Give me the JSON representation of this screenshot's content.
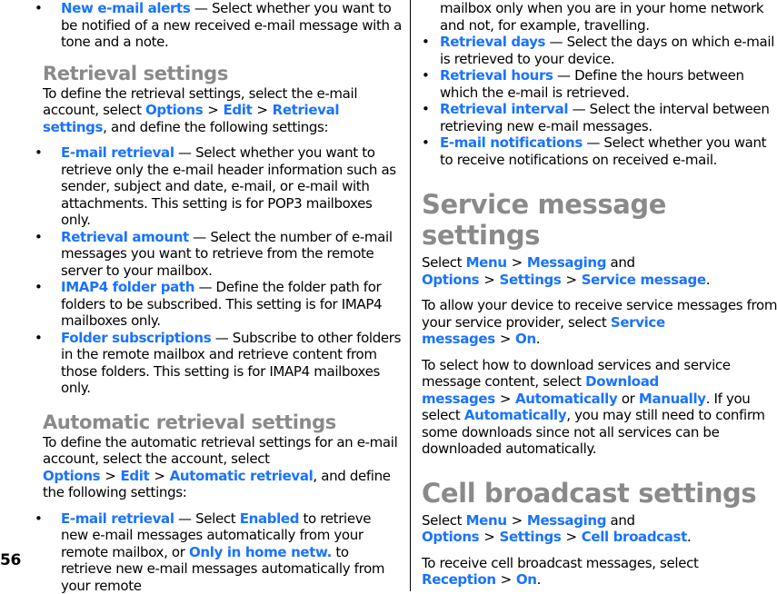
{
  "page_number": "56",
  "left": {
    "intro_item": {
      "term": "New e-mail alerts",
      "desc": " — Select whether you want to be notified of a new received e-mail message with a tone and a note."
    },
    "retrieval": {
      "heading": "Retrieval settings",
      "intro_pre": "To define the retrieval settings, select the e-mail account, select ",
      "path": [
        "Options",
        "Edit",
        "Retrieval settings"
      ],
      "intro_post": ", and define the following settings:",
      "items": [
        {
          "term": "E-mail retrieval",
          "desc": " — Select whether you want to retrieve only the e-mail header information such as sender, subject and date, e-mail, or e-mail with attachments. This setting is for POP3 mailboxes only."
        },
        {
          "term": "Retrieval amount",
          "desc": " — Select the number of e-mail messages you want to retrieve from the remote server to your mailbox."
        },
        {
          "term": "IMAP4 folder path",
          "desc": " — Define the folder path for folders to be subscribed. This setting is for IMAP4 mailboxes only."
        },
        {
          "term": "Folder subscriptions",
          "desc": " — Subscribe to other folders in the remote mailbox and retrieve content from those folders. This setting is for IMAP4 mailboxes only."
        }
      ]
    },
    "automatic": {
      "heading": "Automatic retrieval settings",
      "intro_pre": "To define the automatic retrieval settings for an e-mail account, select the account, select ",
      "path": [
        "Options",
        "Edit",
        "Automatic retrieval"
      ],
      "intro_post": ", and define the following settings:",
      "item0": {
        "term": "E-mail retrieval",
        "desc_a": " — Select ",
        "opt1": "Enabled",
        "desc_b": " to retrieve new e-mail messages automatically from your remote mailbox, or ",
        "opt2": "Only in home netw.",
        "desc_c": " to retrieve new e-mail messages automatically from your remote"
      }
    }
  },
  "right": {
    "continuation": "mailbox only when you are in your home network and not, for example, travelling.",
    "items": [
      {
        "term": "Retrieval days",
        "desc": " — Select the days on which e-mail is retrieved to your device."
      },
      {
        "term": "Retrieval hours",
        "desc": " — Define the hours between which the e-mail is retrieved."
      },
      {
        "term": "Retrieval interval",
        "desc": " — Select the interval between retrieving new e-mail messages."
      },
      {
        "term": "E-mail notifications",
        "desc": " — Select whether you want to receive notifications on received e-mail."
      }
    ],
    "service": {
      "heading": "Service message settings",
      "select_word": "Select ",
      "menu": "Menu",
      "messaging": "Messaging",
      "and_word": " and ",
      "options": "Options",
      "settings": "Settings",
      "target": "Service message",
      "p2_pre": "To allow your device to receive service messages from your service provider, select ",
      "p2_opt": "Service messages",
      "p2_val": "On",
      "p3_pre": "To select how to download services and service message content, select ",
      "p3_opt": "Download messages",
      "p3_val1": "Automatically",
      "p3_or": " or ",
      "p3_val2": "Manually",
      "p3_mid": ". If you select ",
      "p3_val3": "Automatically",
      "p3_post": ", you may still need to confirm some downloads since not all services can be downloaded automatically."
    },
    "cell": {
      "heading": "Cell broadcast settings",
      "select_word": "Select ",
      "menu": "Menu",
      "messaging": "Messaging",
      "and_word": " and ",
      "options": "Options",
      "settings": "Settings",
      "target": "Cell broadcast",
      "p2_pre": "To receive cell broadcast messages, select ",
      "p2_opt": "Reception",
      "p2_val": "On"
    }
  },
  "separator": ">",
  "period": ".",
  "colors": {
    "keyword": "#1a73ff",
    "heading": "#8a8a8a",
    "text": "#000000"
  }
}
